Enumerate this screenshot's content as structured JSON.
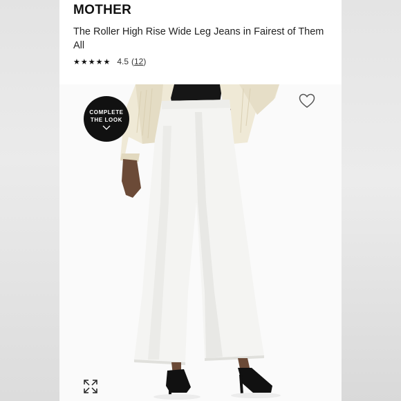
{
  "product": {
    "brand": "MOTHER",
    "title": "The Roller High Rise Wide Leg Jeans in Fairest of Them All",
    "rating": {
      "stars_glyphs": "★★★★★",
      "score": "4.5",
      "count_open": "(",
      "count": "12",
      "count_close": ")"
    }
  },
  "complete_the_look": {
    "line1": "COMPLETE",
    "line2": "THE LOOK",
    "icon": "chevron-down-icon"
  },
  "icons": {
    "favorite": "heart-icon",
    "expand": "expand-icon"
  },
  "colors": {
    "badge": "#111111",
    "text": "#222222",
    "jeans": "#f4f4f2",
    "cardigan": "#efe9d6"
  }
}
